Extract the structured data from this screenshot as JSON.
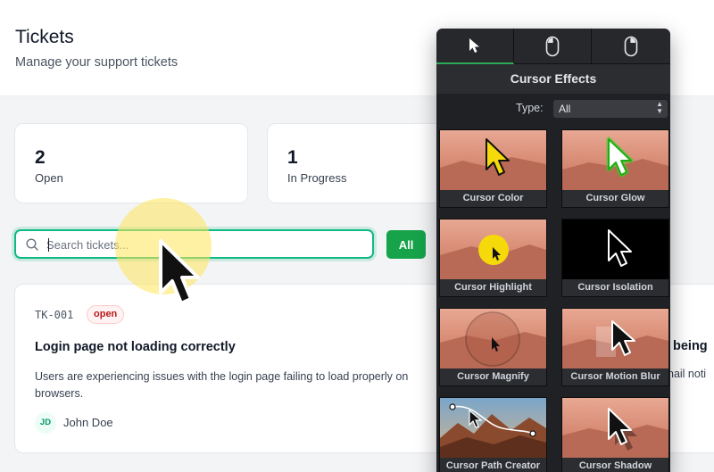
{
  "header": {
    "title": "Tickets",
    "subtitle": "Manage your support tickets"
  },
  "stats": [
    {
      "value": "2",
      "label": "Open"
    },
    {
      "value": "1",
      "label": "In Progress"
    }
  ],
  "search": {
    "placeholder": "Search tickets...",
    "value": ""
  },
  "filters": {
    "all_label": "All"
  },
  "ticket": {
    "id": "TK-001",
    "status": "open",
    "title": "Login page not loading correctly",
    "description": "Users are experiencing issues with the login page failing to load properly on browsers.",
    "assignee_initials": "JD",
    "assignee_name": "John Doe"
  },
  "behind_ticket": {
    "title_fragment": "being",
    "desc_fragment": "nail noti"
  },
  "cursor_effects": {
    "tabs": [
      "cursor-icon",
      "mouse-icon",
      "mouse-right-icon"
    ],
    "title": "Cursor Effects",
    "type_label": "Type:",
    "type_value": "All",
    "items": [
      "Cursor Color",
      "Cursor Glow",
      "Cursor Highlight",
      "Cursor Isolation",
      "Cursor Magnify",
      "Cursor Motion Blur",
      "Cursor Path Creator",
      "Cursor Shadow"
    ]
  },
  "colors": {
    "accent": "#16a34a",
    "focus_ring": "#10b981",
    "highlight": "#fde65a",
    "status_open": "#b91c1c"
  }
}
